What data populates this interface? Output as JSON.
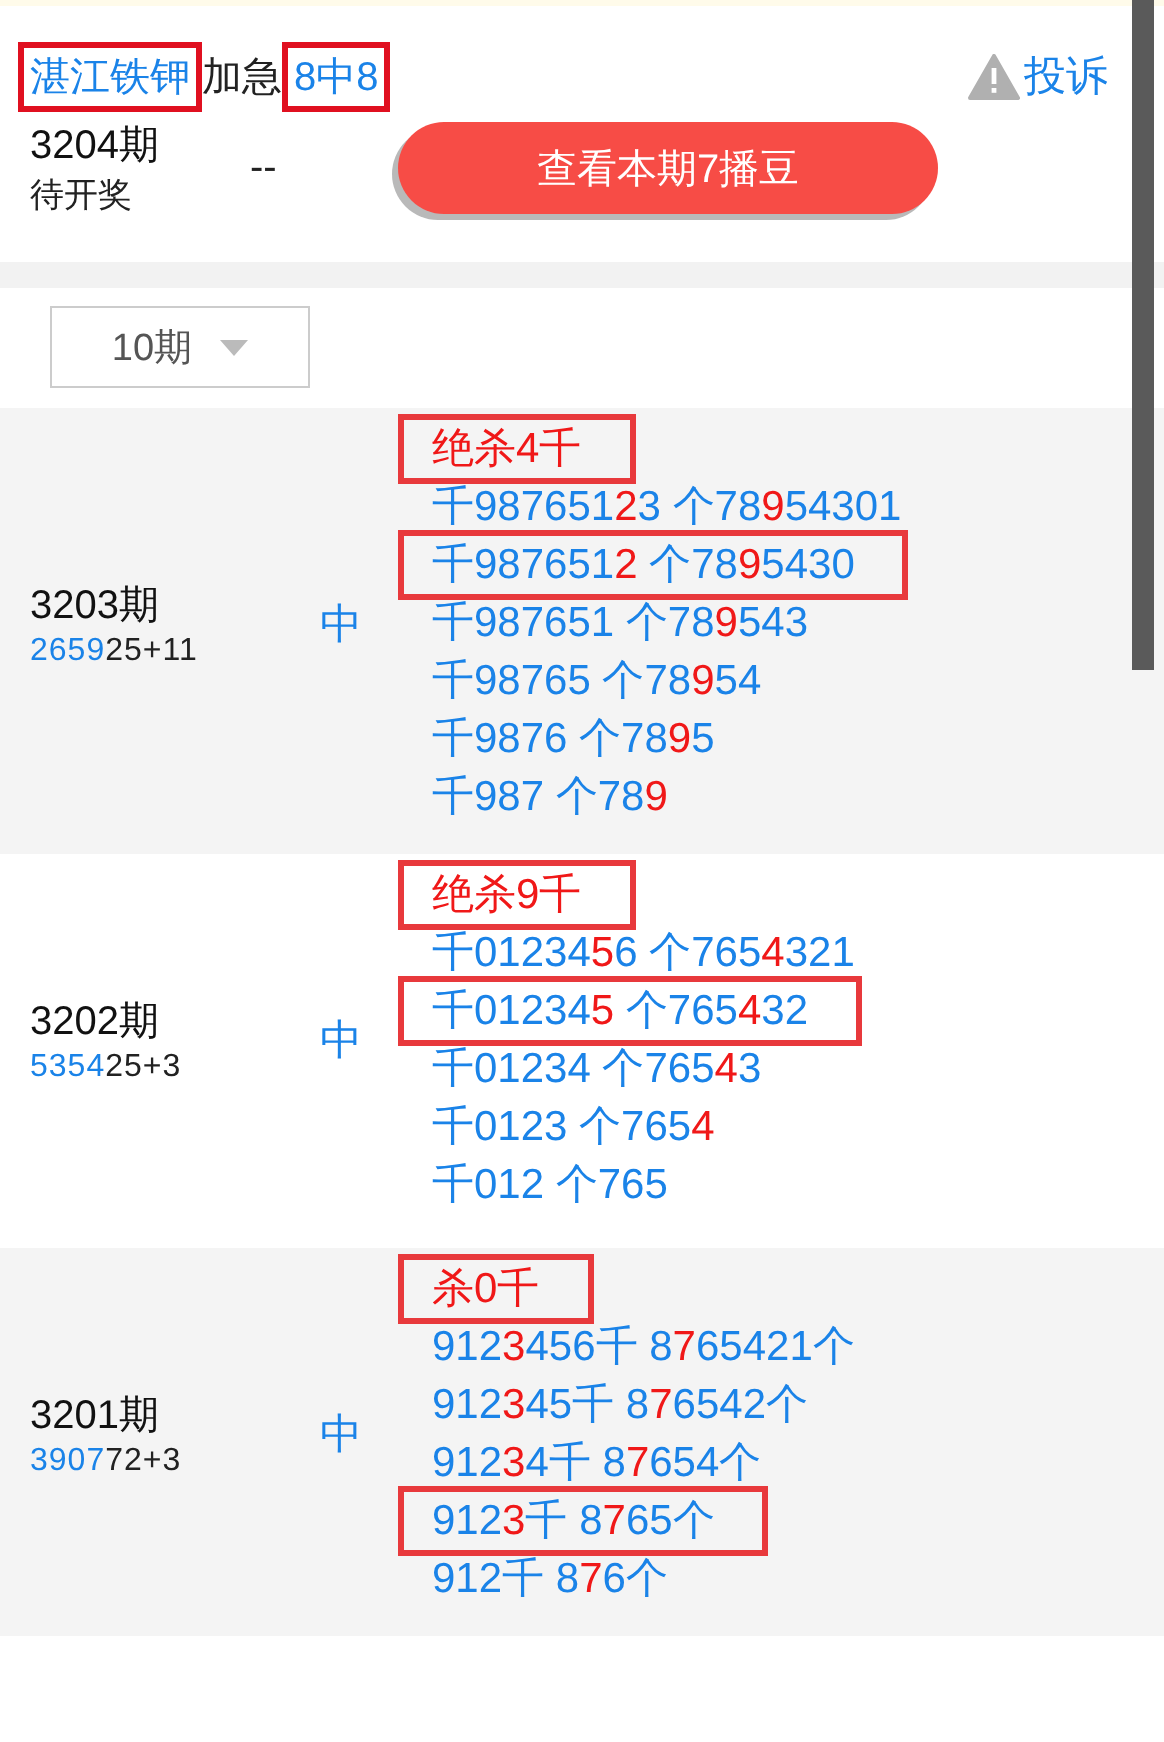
{
  "header": {
    "title": [
      {
        "text": "湛江铁钾",
        "kind": "link",
        "boxed": true
      },
      {
        "text": "加急",
        "kind": "plain",
        "boxed": false
      },
      {
        "text": "8中8",
        "kind": "link",
        "boxed": true
      }
    ],
    "complaint": "投诉",
    "period": "3204期",
    "status": "待开奖",
    "result": "--",
    "button": "查看本期7播豆"
  },
  "filter": {
    "value": "10期"
  },
  "rounds": [
    {
      "period": "3203期",
      "result": [
        {
          "text": "2659",
          "hit": true
        },
        {
          "text": "25+11",
          "hit": false
        }
      ],
      "verdict": "中",
      "lines": [
        {
          "boxed": true,
          "parts": [
            {
              "text": "绝杀4千",
              "hit": true
            }
          ]
        },
        {
          "boxed": false,
          "parts": [
            {
              "text": "千987651",
              "hit": false
            },
            {
              "text": "2",
              "hit": true
            },
            {
              "text": "3 个78",
              "hit": false
            },
            {
              "text": "9",
              "hit": true
            },
            {
              "text": "54301",
              "hit": false
            }
          ]
        },
        {
          "boxed": true,
          "parts": [
            {
              "text": "千987651",
              "hit": false
            },
            {
              "text": "2",
              "hit": true
            },
            {
              "text": " 个78",
              "hit": false
            },
            {
              "text": "9",
              "hit": true
            },
            {
              "text": "5430",
              "hit": false
            }
          ]
        },
        {
          "boxed": false,
          "parts": [
            {
              "text": "千987651 个78",
              "hit": false
            },
            {
              "text": "9",
              "hit": true
            },
            {
              "text": "543",
              "hit": false
            }
          ]
        },
        {
          "boxed": false,
          "parts": [
            {
              "text": "千98765 个78",
              "hit": false
            },
            {
              "text": "9",
              "hit": true
            },
            {
              "text": "54",
              "hit": false
            }
          ]
        },
        {
          "boxed": false,
          "parts": [
            {
              "text": "千9876 个78",
              "hit": false
            },
            {
              "text": "9",
              "hit": true
            },
            {
              "text": "5",
              "hit": false
            }
          ]
        },
        {
          "boxed": false,
          "parts": [
            {
              "text": "千987 个78",
              "hit": false
            },
            {
              "text": "9",
              "hit": true
            }
          ]
        }
      ]
    },
    {
      "period": "3202期",
      "result": [
        {
          "text": "5354",
          "hit": true
        },
        {
          "text": "25+3",
          "hit": false
        }
      ],
      "verdict": "中",
      "lines": [
        {
          "boxed": true,
          "parts": [
            {
              "text": "绝杀9千",
              "hit": true
            }
          ]
        },
        {
          "boxed": false,
          "parts": [
            {
              "text": "千01234",
              "hit": false
            },
            {
              "text": "5",
              "hit": true
            },
            {
              "text": "6 个765",
              "hit": false
            },
            {
              "text": "4",
              "hit": true
            },
            {
              "text": "321",
              "hit": false
            }
          ]
        },
        {
          "boxed": true,
          "parts": [
            {
              "text": "千01234",
              "hit": false
            },
            {
              "text": "5",
              "hit": true
            },
            {
              "text": " 个765",
              "hit": false
            },
            {
              "text": "4",
              "hit": true
            },
            {
              "text": "32",
              "hit": false
            }
          ]
        },
        {
          "boxed": false,
          "parts": [
            {
              "text": "千01234 个765",
              "hit": false
            },
            {
              "text": "4",
              "hit": true
            },
            {
              "text": "3",
              "hit": false
            }
          ]
        },
        {
          "boxed": false,
          "parts": [
            {
              "text": "千0123 个765",
              "hit": false
            },
            {
              "text": "4",
              "hit": true
            }
          ]
        },
        {
          "boxed": false,
          "parts": [
            {
              "text": "千012 个765",
              "hit": false
            }
          ]
        }
      ]
    },
    {
      "period": "3201期",
      "result": [
        {
          "text": "3907",
          "hit": true
        },
        {
          "text": "72+3",
          "hit": false
        }
      ],
      "verdict": "中",
      "lines": [
        {
          "boxed": true,
          "parts": [
            {
              "text": "杀0千",
              "hit": true
            }
          ]
        },
        {
          "boxed": false,
          "parts": [
            {
              "text": "912",
              "hit": false
            },
            {
              "text": "3",
              "hit": true
            },
            {
              "text": "456千 8",
              "hit": false
            },
            {
              "text": "7",
              "hit": true
            },
            {
              "text": "65421个",
              "hit": false
            }
          ]
        },
        {
          "boxed": false,
          "parts": [
            {
              "text": "912",
              "hit": false
            },
            {
              "text": "3",
              "hit": true
            },
            {
              "text": "45千 8",
              "hit": false
            },
            {
              "text": "7",
              "hit": true
            },
            {
              "text": "6542个",
              "hit": false
            }
          ]
        },
        {
          "boxed": false,
          "parts": [
            {
              "text": "912",
              "hit": false
            },
            {
              "text": "3",
              "hit": true
            },
            {
              "text": "4千 8",
              "hit": false
            },
            {
              "text": "7",
              "hit": true
            },
            {
              "text": "654个",
              "hit": false
            }
          ]
        },
        {
          "boxed": true,
          "parts": [
            {
              "text": "912",
              "hit": false
            },
            {
              "text": "3",
              "hit": true
            },
            {
              "text": "千 8",
              "hit": false
            },
            {
              "text": "7",
              "hit": true
            },
            {
              "text": "65个",
              "hit": false
            }
          ]
        },
        {
          "boxed": false,
          "parts": [
            {
              "text": "912千 8",
              "hit": false
            },
            {
              "text": "7",
              "hit": true
            },
            {
              "text": "6个",
              "hit": false
            }
          ]
        }
      ]
    }
  ]
}
